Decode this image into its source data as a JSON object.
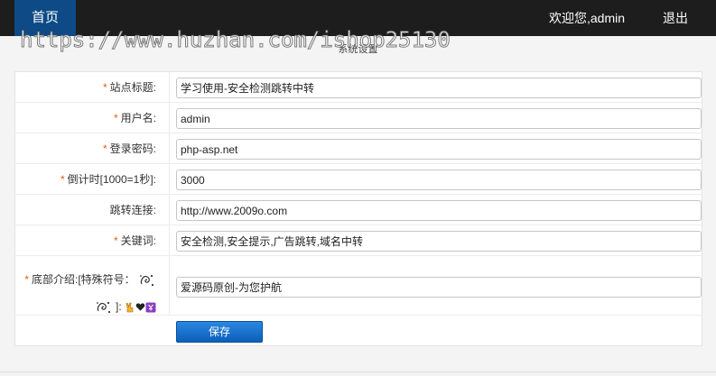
{
  "header": {
    "home_label": "首页",
    "welcome_text": "欢迎您,admin",
    "logout_label": "退出"
  },
  "watermark": "https://www.huzhan.com/ishop25130",
  "panel": {
    "title": "系统设置"
  },
  "form": {
    "site_title": {
      "required": "*",
      "label": "站点标题:",
      "value": "学习使用-安全检测跳转中转"
    },
    "username": {
      "required": "*",
      "label": "用户名:",
      "value": "admin"
    },
    "password": {
      "required": "*",
      "label": "登录密码:",
      "value": "php-asp.net"
    },
    "countdown": {
      "required": "*",
      "label": "倒计时[1000=1秒]:",
      "value": "3000"
    },
    "redirect_url": {
      "label": "跳转连接:",
      "value": "http://www.2009o.com"
    },
    "keywords": {
      "required": "*",
      "label": "关键词:",
      "value": "安全检测,安全提示,广告跳转,域名中转"
    },
    "footer_intro": {
      "required": "*",
      "label_line1": "底部介绍:[特殊符号：",
      "label_line2": "]:",
      "value": "爱源码原创-为您护航"
    },
    "save_label": "保存"
  },
  "colors": {
    "topbar": "#1d1d1d",
    "home_active": "#0d4a86",
    "required_star": "#e06010",
    "save_button": "#1570cc"
  }
}
